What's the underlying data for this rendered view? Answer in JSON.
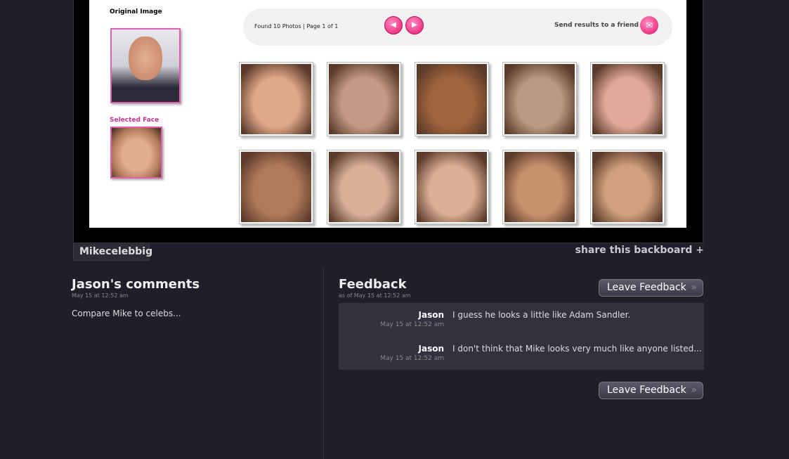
{
  "viewer": {
    "original_label": "Original Image",
    "selected_label": "Selected Face",
    "found_text": "Found 10 Photos | Page 1 of 1",
    "send_label": "Send results to a friend",
    "thumbs": [
      "#e0a888",
      "#c49a84",
      "#a0643c",
      "#b89a80",
      "#e0a898",
      "#b07a5a",
      "#d8b098",
      "#dcae94",
      "#c8906c",
      "#d0a07c"
    ]
  },
  "board": {
    "tab": "Mikecelebbig",
    "share": "share this backboard +"
  },
  "comments": {
    "title": "Jason's comments",
    "date": "May 15 at 12:52 am",
    "text": "Compare Mike to celebs..."
  },
  "feedback": {
    "title": "Feedback",
    "date": "as of May 15 at 12:52 am",
    "button": "Leave Feedback",
    "chevron": "»",
    "items": [
      {
        "name": "Jason",
        "date": "May 15 at 12:52 am",
        "text": "I guess he looks a little like Adam Sandler."
      },
      {
        "name": "Jason",
        "date": "May 15 at 12:52 am",
        "text": "I don't think that Mike looks very much like anyone listed..."
      }
    ]
  }
}
